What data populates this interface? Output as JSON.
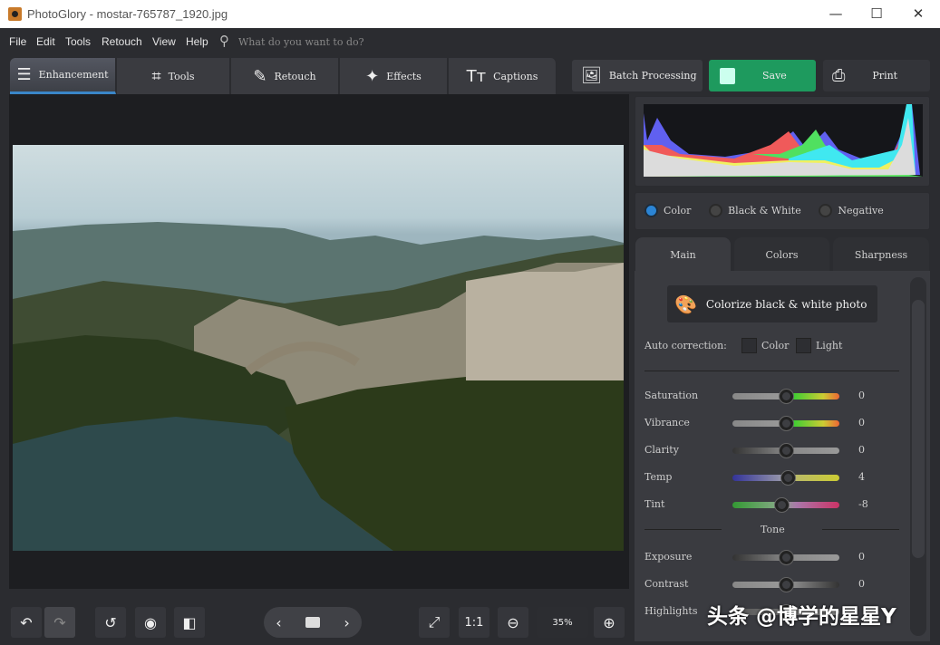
{
  "window": {
    "title": "PhotoGlory - mostar-765787_1920.jpg",
    "minimize": "—",
    "maximize": "☐",
    "close": "✕"
  },
  "menu": {
    "items": [
      "File",
      "Edit",
      "Tools",
      "Retouch",
      "View",
      "Help"
    ],
    "search_placeholder": "What do you want to do?"
  },
  "tabs": [
    {
      "label": "Enhancement",
      "icon": "sliders-icon",
      "glyph": "☰"
    },
    {
      "label": "Tools",
      "icon": "crop-icon",
      "glyph": "⌗"
    },
    {
      "label": "Retouch",
      "icon": "brush-icon",
      "glyph": "✎"
    },
    {
      "label": "Effects",
      "icon": "magic-wand-icon",
      "glyph": "✦"
    },
    {
      "label": "Captions",
      "icon": "text-icon",
      "glyph": "Tт"
    }
  ],
  "actions": {
    "batch": "Batch Processing",
    "save": "Save",
    "print": "Print",
    "save_color": "#1e9a5e"
  },
  "mode": {
    "options": [
      "Color",
      "Black & White",
      "Negative"
    ],
    "selected": "Color"
  },
  "panel_tabs": [
    "Main",
    "Colors",
    "Sharpness"
  ],
  "main": {
    "colorize": "Colorize black & white photo",
    "auto_label": "Auto correction:",
    "auto_color": "Color",
    "auto_light": "Light",
    "tone_label": "Tone",
    "sliders": [
      {
        "label": "Saturation",
        "value": "0",
        "pos": 0
      },
      {
        "label": "Vibrance",
        "value": "0",
        "pos": 0
      },
      {
        "label": "Clarity",
        "value": "0",
        "pos": 0
      },
      {
        "label": "Temp",
        "value": "4",
        "pos": 4
      },
      {
        "label": "Tint",
        "value": "-8",
        "pos": -8
      }
    ],
    "tone_sliders": [
      {
        "label": "Exposure",
        "value": "0",
        "pos": 0
      },
      {
        "label": "Contrast",
        "value": "0",
        "pos": 0
      },
      {
        "label": "Highlights",
        "value": "",
        "pos": 0
      }
    ]
  },
  "bottom": {
    "one_to_one": "1:1",
    "zoom": "35%"
  },
  "watermark": "头条 @博学的星星Y"
}
